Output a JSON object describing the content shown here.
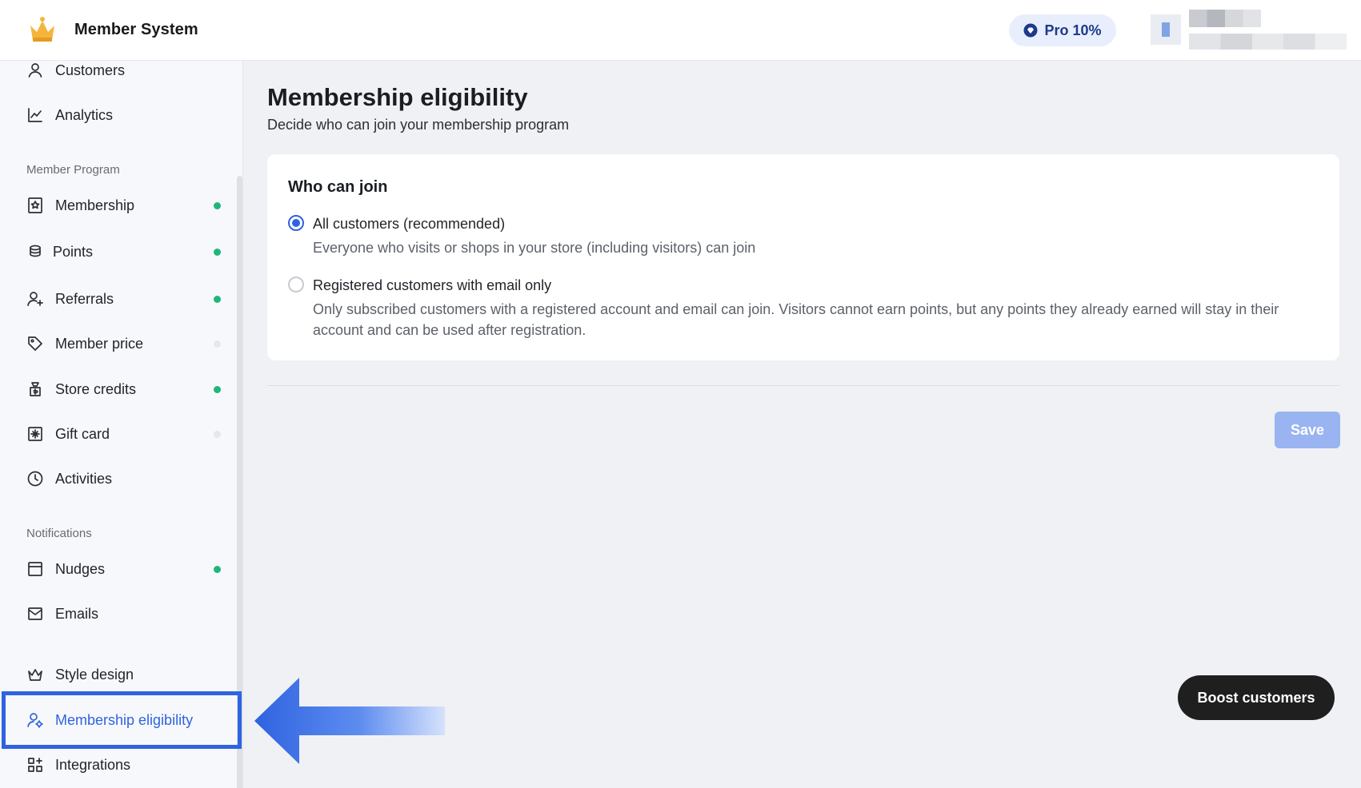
{
  "app": {
    "title": "Member System",
    "plan_badge": "Pro 10%",
    "brand_color": "#2f63e0"
  },
  "sidebar": {
    "top_items": [
      {
        "label": "Customers",
        "icon": "user-icon"
      },
      {
        "label": "Analytics",
        "icon": "chart-line-icon"
      }
    ],
    "sections": [
      {
        "title": "Member Program",
        "items": [
          {
            "label": "Membership",
            "icon": "badge-icon",
            "enabled": true
          },
          {
            "label": "Points",
            "icon": "coins-icon",
            "enabled": true
          },
          {
            "label": "Referrals",
            "icon": "user-plus-icon",
            "enabled": true
          },
          {
            "label": "Member price",
            "icon": "tag-icon",
            "enabled": false
          },
          {
            "label": "Store credits",
            "icon": "money-bag-icon",
            "enabled": true
          },
          {
            "label": "Gift card",
            "icon": "gift-card-icon",
            "enabled": false
          },
          {
            "label": "Activities",
            "icon": "clock-icon"
          }
        ]
      },
      {
        "title": "Notifications",
        "items": [
          {
            "label": "Nudges",
            "icon": "window-icon",
            "enabled": true
          },
          {
            "label": "Emails",
            "icon": "mail-icon"
          }
        ]
      }
    ],
    "bottom_items": [
      {
        "label": "Style design",
        "icon": "crown-outline-icon"
      },
      {
        "label": "Membership eligibility",
        "icon": "user-settings-icon",
        "active": true
      },
      {
        "label": "Integrations",
        "icon": "apps-icon"
      }
    ]
  },
  "main": {
    "title": "Membership eligibility",
    "subtitle": "Decide who can join your membership program",
    "card": {
      "title": "Who can join",
      "options": [
        {
          "label": "All customers (recommended)",
          "description": "Everyone who visits or shops in your store (including visitors) can join",
          "selected": true
        },
        {
          "label": "Registered customers with email only",
          "description": "Only subscribed customers with a registered account and email can join. Visitors cannot earn points, but any points they already earned will stay in their account and can be used after registration.",
          "selected": false
        }
      ]
    },
    "save_label": "Save",
    "boost_label": "Boost customers"
  }
}
